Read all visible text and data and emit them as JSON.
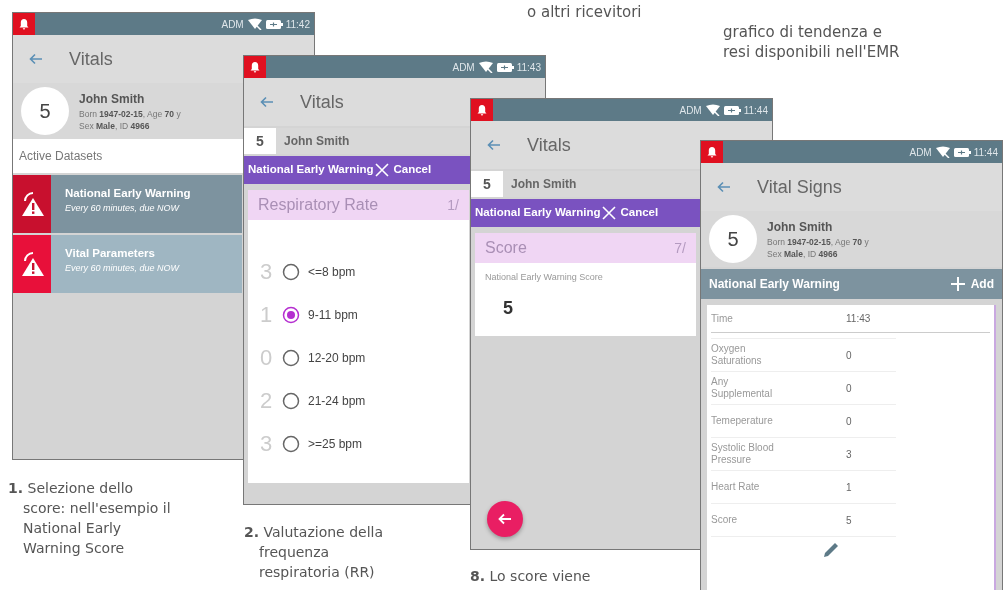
{
  "captions_top": [
    {
      "text": "o altri ricevitori"
    },
    {
      "text": "grafico di tendenza e\nresi disponibili nell'EMR"
    }
  ],
  "screens": [
    {
      "kind": "datasets",
      "status": {
        "operator": "ADM",
        "time": "11:42"
      },
      "title": "Vitals",
      "patient": {
        "score": "5",
        "name": "John Smith",
        "details": [
          "Born **1947-02-15**, Age **70** y",
          "Sex **Male**, ID **4966**"
        ]
      },
      "section_label": "Active Datasets",
      "datasets": [
        {
          "name": "National Early Warning",
          "schedule": "Every 60 minutes, due NOW",
          "selected": true
        },
        {
          "name": "Vital Parameters",
          "schedule": "Every 60 minutes, due NOW",
          "selected": false
        }
      ],
      "caption": "**1.** Selezione dello score: nell'esempio il National Early Warning Score"
    },
    {
      "kind": "question",
      "status": {
        "operator": "ADM",
        "time": "11:43"
      },
      "title": "Vitals",
      "patient": {
        "score": "5",
        "name": "John Smith"
      },
      "form_bar": {
        "title": "National Early Warning",
        "cancel": "Cancel"
      },
      "question": {
        "title": "Respiratory Rate",
        "counter": "1/"
      },
      "options": [
        {
          "points": "3",
          "label": "<=8 bpm",
          "selected": false
        },
        {
          "points": "1",
          "label": "9-11 bpm",
          "selected": true
        },
        {
          "points": "0",
          "label": "12-20 bpm",
          "selected": false
        },
        {
          "points": "2",
          "label": "21-24 bpm",
          "selected": false
        },
        {
          "points": "3",
          "label": ">=25 bpm",
          "selected": false
        }
      ],
      "caption": "**2.** Valutazione della frequenza respiratoria (RR)"
    },
    {
      "kind": "score",
      "status": {
        "operator": "ADM",
        "time": "11:44"
      },
      "title": "Vitals",
      "patient": {
        "score": "5",
        "name": "John Smith"
      },
      "form_bar": {
        "title": "National Early Warning",
        "cancel": "Cancel"
      },
      "question": {
        "title": "Score",
        "counter": "7/"
      },
      "field_label": "National Early Warning Score",
      "value": "5",
      "caption": "**8.** Lo score viene"
    },
    {
      "kind": "summary",
      "status": {
        "operator": "ADM",
        "time": "11:44"
      },
      "title": "Vital Signs",
      "patient": {
        "score": "5",
        "name": "John Smith",
        "details": [
          "Born **1947-02-15**, Age **70** y",
          "Sex **Male**, ID **4966**"
        ]
      },
      "group_bar": {
        "title": "National Early Warning",
        "action": "Add"
      },
      "rows": [
        {
          "kind": "header",
          "label": "Time",
          "value": "11:43"
        },
        {
          "kind": "cut"
        },
        {
          "kind": "row",
          "label": "Oxygen\nSaturations",
          "value": "0"
        },
        {
          "kind": "row",
          "label": "Any\nSupplemental",
          "value": "0"
        },
        {
          "kind": "row",
          "label": "Temeperature",
          "value": "0"
        },
        {
          "kind": "row",
          "label": "Systolic Blood\nPressure",
          "value": "3"
        },
        {
          "kind": "row",
          "label": "Heart Rate",
          "value": "1"
        },
        {
          "kind": "row",
          "label": "Score",
          "value": "5"
        }
      ]
    }
  ]
}
